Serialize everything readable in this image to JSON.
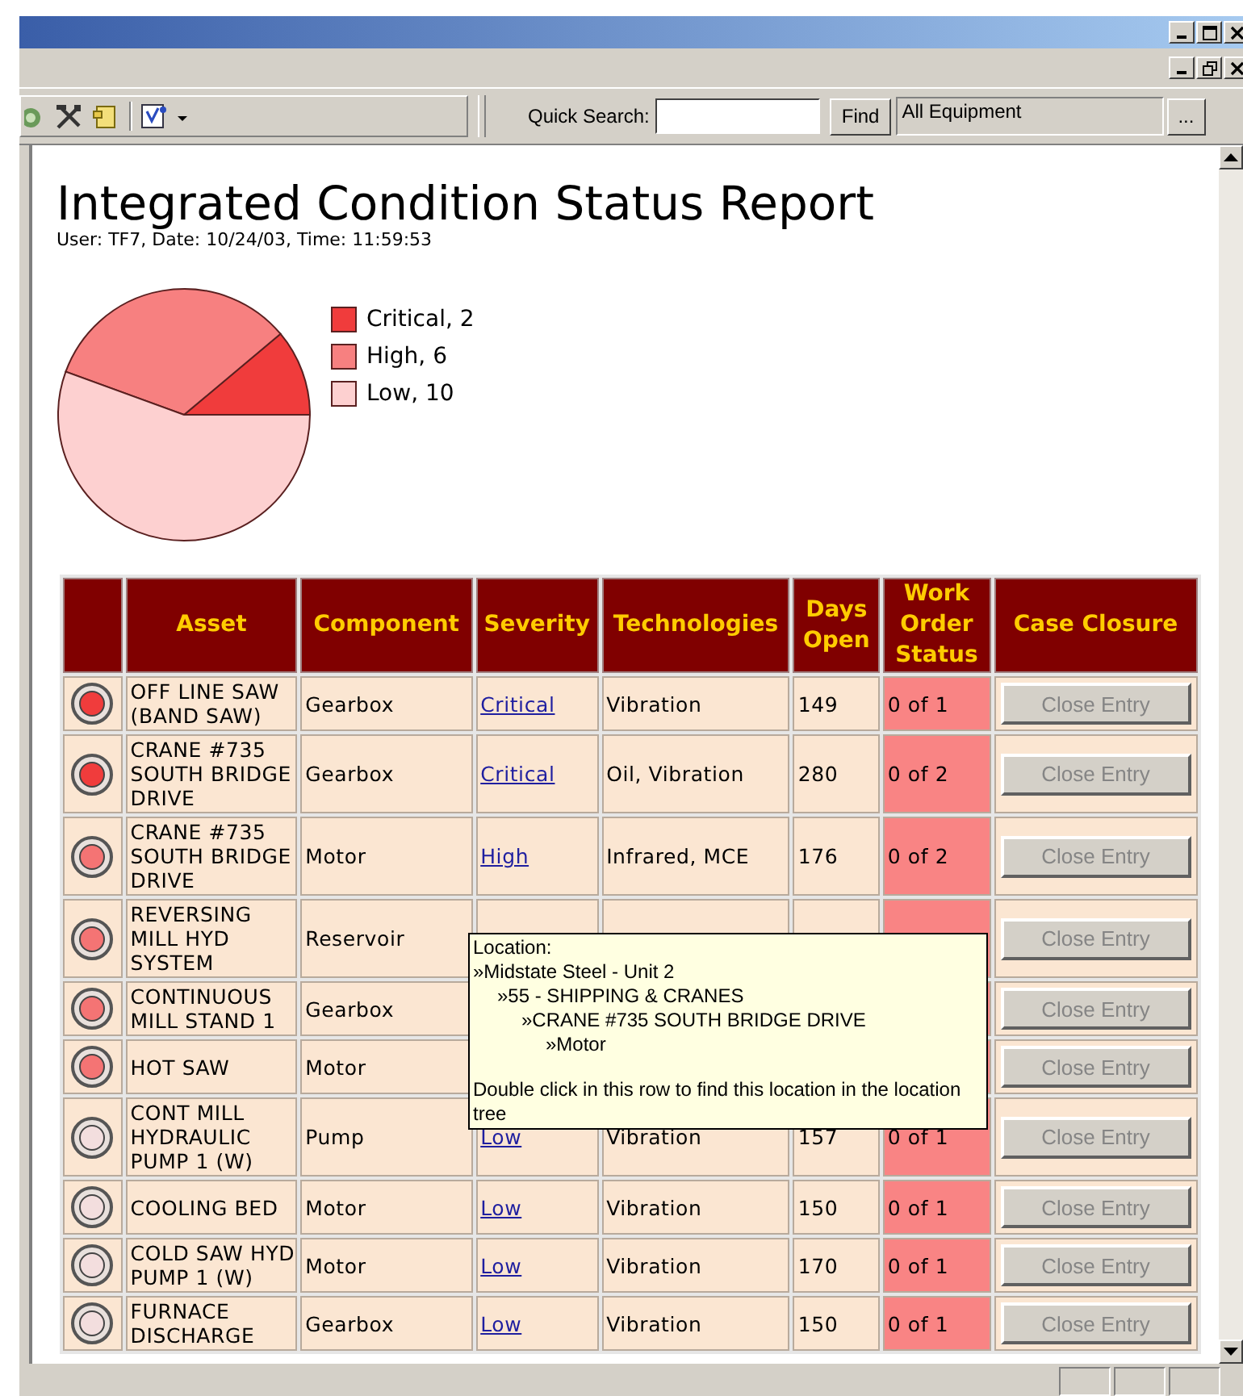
{
  "toolbar": {
    "search_label": "Quick Search:",
    "find_button": "Find",
    "scope_field": "All Equipment",
    "browse_button": "..."
  },
  "report": {
    "title": "Integrated Condition Status Report",
    "subtitle": "User: TF7, Date: 10/24/03, Time: 11:59:53"
  },
  "legend": [
    {
      "color": "#f03c3c"
    },
    {
      "color": "#f78080"
    },
    {
      "color": "#fdd0d0"
    }
  ],
  "chart_data": {
    "type": "pie",
    "categories": [
      "Critical, 2",
      "High, 6",
      "Low, 10"
    ],
    "values": [
      2,
      6,
      10
    ]
  },
  "table": {
    "columns": [
      "",
      "Asset",
      "Component",
      "Severity",
      "Technologies",
      "Days Open",
      "Work Order Status",
      "Case Closure"
    ],
    "rows": [
      {
        "color": "#f03c3c",
        "asset": "OFF LINE SAW (BAND SAW)",
        "component": "Gearbox",
        "severity": "Critical",
        "technologies": "Vibration",
        "days_open": "149",
        "work_order": "0 of 1",
        "action": "Close Entry",
        "disabled": true
      },
      {
        "color": "#f03c3c",
        "asset": "CRANE #735 SOUTH BRIDGE DRIVE",
        "component": "Gearbox",
        "severity": "Critical",
        "technologies": "Oil, Vibration",
        "days_open": "280",
        "work_order": "0 of 2",
        "action": "Close Entry",
        "disabled": true
      },
      {
        "color": "#f47474",
        "asset": "CRANE #735 SOUTH BRIDGE DRIVE",
        "component": "Motor",
        "severity": "High",
        "technologies": "Infrared, MCE",
        "days_open": "176",
        "work_order": "0 of 2",
        "action": "Close Entry",
        "disabled": true
      },
      {
        "color": "#f47474",
        "asset": "REVERSING MILL HYD SYSTEM",
        "component": "Reservoir",
        "action": "Close Entry",
        "disabled": true
      },
      {
        "color": "#f47474",
        "asset": "CONTINUOUS MILL STAND 1",
        "component": "Gearbox",
        "action": "Close Entry",
        "disabled": true
      },
      {
        "color": "#f47474",
        "asset": "HOT SAW",
        "component": "Motor",
        "action": "Close Entry",
        "disabled": true
      },
      {
        "color": "#f3dede",
        "asset": "CONT MILL HYDRAULIC PUMP 1 (W)",
        "component": "Pump",
        "severity": "Low",
        "technologies": "Vibration",
        "days_open": "157",
        "work_order": "0 of 1",
        "action": "Close Entry",
        "disabled": true
      },
      {
        "color": "#f3dede",
        "asset": "COOLING BED",
        "component": "Motor",
        "severity": "Low",
        "technologies": "Vibration",
        "days_open": "150",
        "work_order": "0 of 1",
        "action": "Close Entry",
        "disabled": true
      },
      {
        "color": "#f3dede",
        "asset": "COLD SAW HYD PUMP 1 (W)",
        "component": "Motor",
        "severity": "Low",
        "technologies": "Vibration",
        "days_open": "170",
        "work_order": "0 of 1",
        "action": "Close Entry",
        "disabled": true
      },
      {
        "color": "#f3dede",
        "asset": "FURNACE DISCHARGE",
        "component": "Gearbox",
        "severity": "Low",
        "technologies": "Vibration",
        "days_open": "150",
        "work_order": "0 of 1",
        "action": "Close Entry",
        "disabled": true
      }
    ]
  },
  "tooltip": {
    "heading": "Location:",
    "path": [
      {
        "text": "»Midstate Steel - Unit 2",
        "children": [
          {
            "text": "»55 - SHIPPING & CRANES",
            "children": [
              {
                "text": "»CRANE #735 SOUTH BRIDGE DRIVE",
                "children": [
                  {
                    "text": "»Motor"
                  }
                ]
              }
            ]
          }
        ]
      }
    ],
    "hint": "Double click in this row to find this location in the location tree"
  }
}
